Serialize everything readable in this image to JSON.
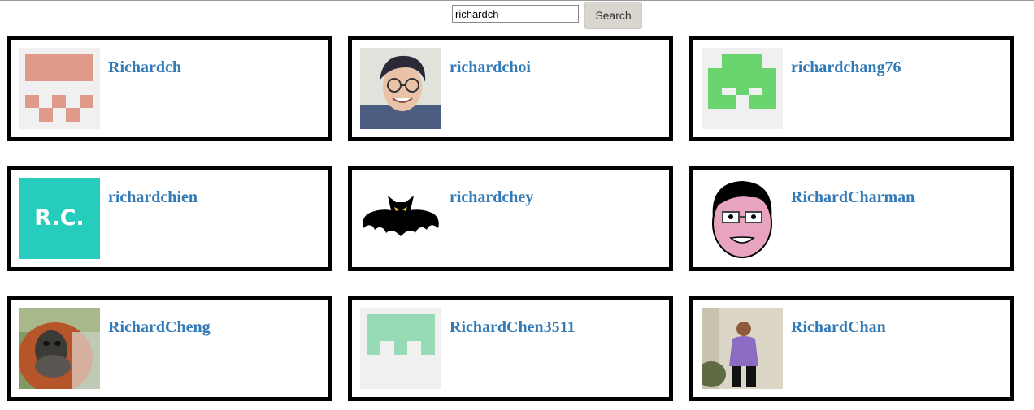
{
  "search": {
    "value": "richardch",
    "button_label": "Search"
  },
  "colors": {
    "username_link": "#337ab7",
    "card_border": "#000000",
    "search_button_bg": "#d9d5cf"
  },
  "users": [
    {
      "username": "Richardch",
      "avatar": "identicon-salmon-icon"
    },
    {
      "username": "richardchoi",
      "avatar": "photo-man-glasses-smiling"
    },
    {
      "username": "richardchang76",
      "avatar": "identicon-green-icon"
    },
    {
      "username": "richardchien",
      "avatar": "initials-rc-avatar",
      "avatar_text": "R.C."
    },
    {
      "username": "richardchey",
      "avatar": "black-bat-icon"
    },
    {
      "username": "RichardCharman",
      "avatar": "cartoon-man-glasses"
    },
    {
      "username": "RichardCheng",
      "avatar": "photo-orangutan"
    },
    {
      "username": "RichardChen3511",
      "avatar": "identicon-mint-icon"
    },
    {
      "username": "RichardChan",
      "avatar": "photo-man-purple-shirt"
    }
  ]
}
